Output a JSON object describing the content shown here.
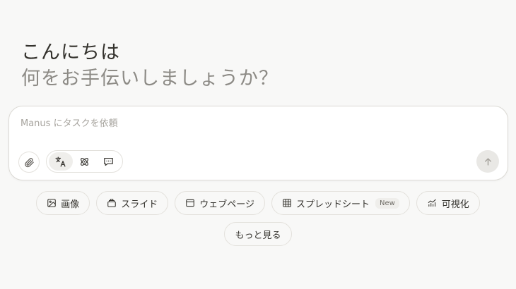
{
  "greeting": {
    "line1": "こんにちは",
    "line2": "何をお手伝いしましょうか？"
  },
  "composer": {
    "placeholder": "Manus にタスクを依頼",
    "value": "",
    "icons": {
      "attach": "paperclip-icon",
      "modes": [
        "translate-icon",
        "atom-icon",
        "chat-bubble-icon"
      ],
      "send": "arrow-up-icon"
    }
  },
  "quick_actions": [
    {
      "label": "画像",
      "icon": "image-icon"
    },
    {
      "label": "スライド",
      "icon": "slides-icon"
    },
    {
      "label": "ウェブページ",
      "icon": "browser-window-icon"
    },
    {
      "label": "スプレッドシート",
      "icon": "table-grid-icon",
      "badge": "New"
    },
    {
      "label": "可視化",
      "icon": "chart-icon"
    }
  ],
  "more_label": "もっと見る",
  "colors": {
    "background": "#f8f8f7",
    "text": "#34322d",
    "muted_text": "#8d8b86",
    "border": "#dcdad5"
  }
}
